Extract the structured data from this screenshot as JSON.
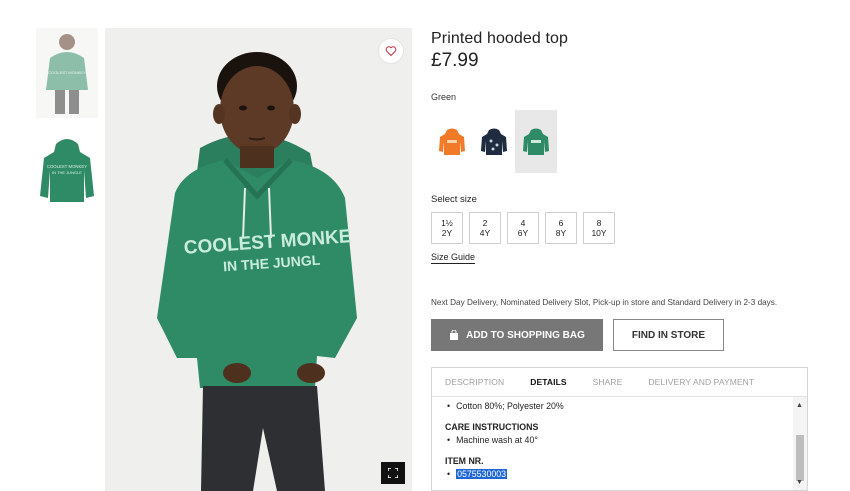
{
  "product": {
    "title": "Printed hooded top",
    "price": "£7.99",
    "color_label": "Green",
    "print_line1": "COOLEST MONKE",
    "print_line2": "IN THE JUNGL"
  },
  "swatches": [
    {
      "name": "orange",
      "color": "#f07a28"
    },
    {
      "name": "navy-print",
      "color": "#1f2b3e"
    },
    {
      "name": "green",
      "color": "#2f8a66"
    }
  ],
  "sizes": {
    "label": "Select size",
    "options": [
      {
        "top": "1½",
        "bottom": "2Y"
      },
      {
        "top": "2",
        "bottom": "4Y"
      },
      {
        "top": "4",
        "bottom": "6Y"
      },
      {
        "top": "6",
        "bottom": "8Y"
      },
      {
        "top": "8",
        "bottom": "10Y"
      }
    ],
    "guide": "Size Guide"
  },
  "delivery_text": "Next Day Delivery, Nominated Delivery Slot, Pick-up in store and Standard Delivery in 2-3 days.",
  "buttons": {
    "add_to_bag": "ADD TO SHOPPING BAG",
    "find_in_store": "FIND IN STORE"
  },
  "tabs": [
    {
      "label": "DESCRIPTION",
      "active": false
    },
    {
      "label": "DETAILS",
      "active": true
    },
    {
      "label": "SHARE",
      "active": false
    },
    {
      "label": "DELIVERY AND PAYMENT",
      "active": false
    }
  ],
  "details": {
    "composition": "Cotton 80%; Polyester 20%",
    "care_heading": "CARE INSTRUCTIONS",
    "care": "Machine wash at 40°",
    "item_heading": "ITEM NR.",
    "item_number": "0575530003"
  },
  "icons": {
    "favorite": "heart-icon",
    "zoom": "expand-icon",
    "bag": "shopping-bag-icon"
  },
  "colors": {
    "hoodie": "#2f8a66",
    "button_bag": "#777777",
    "selection": "#1e66d6"
  }
}
